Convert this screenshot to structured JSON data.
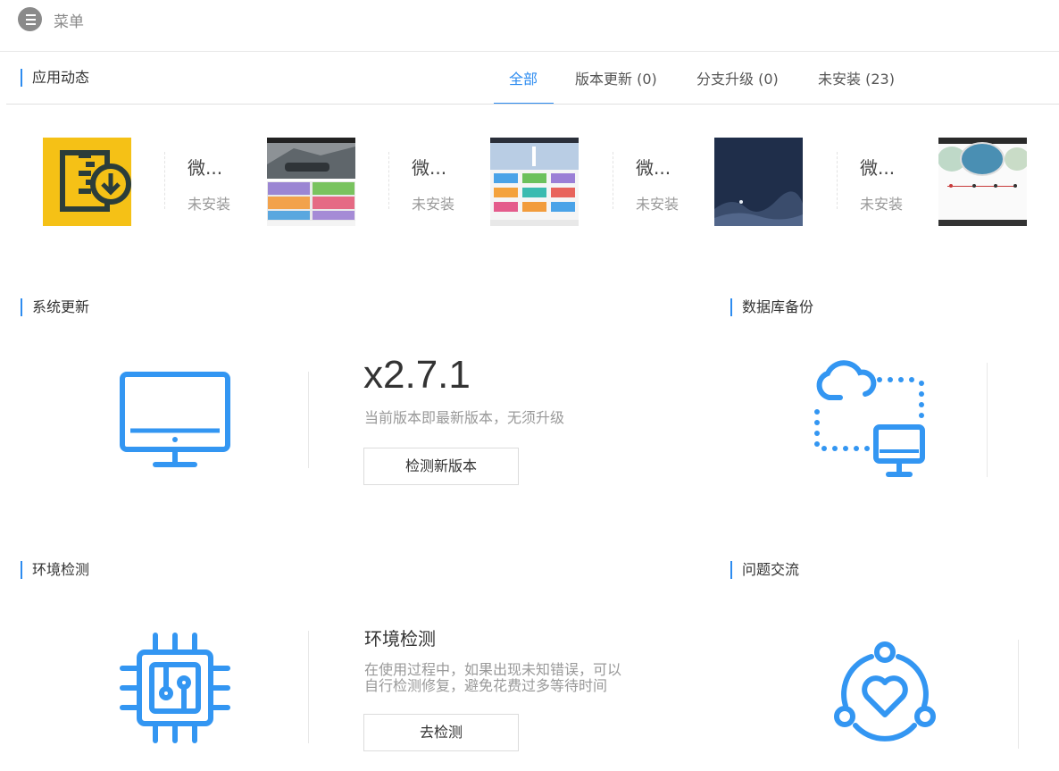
{
  "menu": {
    "label": "菜单",
    "icon": "menu-list-icon"
  },
  "app_feed": {
    "title": "应用动态",
    "tabs": [
      {
        "label": "全部",
        "active": true
      },
      {
        "label": "版本更新 (0)",
        "active": false
      },
      {
        "label": "分支升级 (0)",
        "active": false
      },
      {
        "label": "未安装 (23)",
        "active": false
      }
    ],
    "apps": [
      {
        "name": "微...",
        "status": "未安装"
      },
      {
        "name": "微...",
        "status": "未安装"
      },
      {
        "name": "微...",
        "status": "未安装"
      },
      {
        "name": "微...",
        "status": "未安装"
      }
    ]
  },
  "system_update": {
    "title": "系统更新",
    "version": "x2.7.1",
    "description": "当前版本即最新版本，无须升级",
    "button": "检测新版本",
    "icon": "monitor-icon"
  },
  "db_backup": {
    "title": "数据库备份",
    "icon": "cloud-backup-icon"
  },
  "env_check": {
    "title": "环境检测",
    "heading": "环境检测",
    "description_line1": "在使用过程中，如果出现未知错误，可以",
    "description_line2": "自行检测修复，避免花费过多等待时间",
    "button": "去检测",
    "icon": "chip-icon"
  },
  "feedback": {
    "title": "问题交流",
    "icon": "heart-community-icon"
  },
  "colors": {
    "accent": "#2d8cf0",
    "icon_blue": "#3396f2"
  }
}
